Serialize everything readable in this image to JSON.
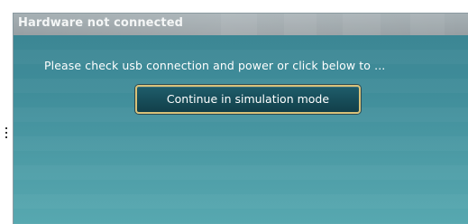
{
  "dialog": {
    "title": "Hardware not connected",
    "message": "Please check usb connection and power or click below to ...",
    "simulation_button_label": "Continue in simulation mode"
  },
  "colors": {
    "title_bar": "#9ea8ac",
    "dialog_background": "#408c98",
    "button_background": "#174c58",
    "button_border": "#d9c27a",
    "text": "#ffffff"
  }
}
